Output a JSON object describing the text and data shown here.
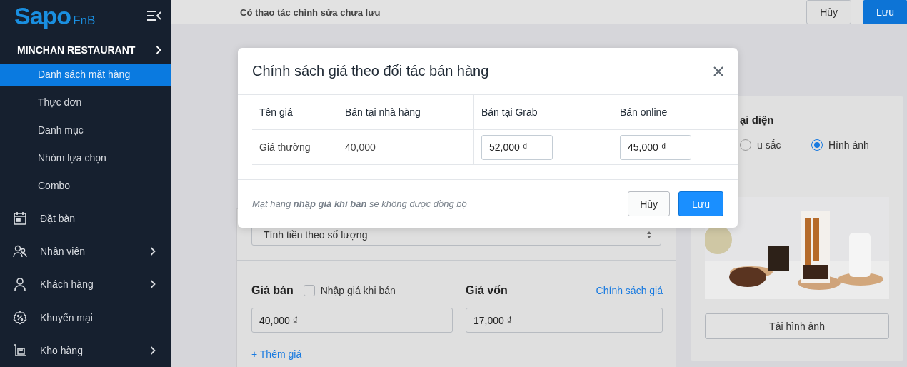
{
  "sidebar": {
    "logo": {
      "brand": "Sapo",
      "suffix": "FnB"
    },
    "store": "MINCHAN RESTAURANT",
    "sub_items": [
      {
        "label": "Danh sách mặt hàng",
        "selected": true
      },
      {
        "label": "Thực đơn",
        "selected": false
      },
      {
        "label": "Danh mục",
        "selected": false
      },
      {
        "label": "Nhóm lựa chọn",
        "selected": false
      },
      {
        "label": "Combo",
        "selected": false
      }
    ],
    "items": [
      {
        "label": "Đặt bàn",
        "has_children": false
      },
      {
        "label": "Nhân viên",
        "has_children": true
      },
      {
        "label": "Khách hàng",
        "has_children": true
      },
      {
        "label": "Khuyến mại",
        "has_children": false
      },
      {
        "label": "Kho hàng",
        "has_children": true
      }
    ]
  },
  "top_bar": {
    "message": "Có thao tác chỉnh sửa chưa lưu",
    "buttons": [
      {
        "label": "Hủy",
        "kind": "secondary"
      },
      {
        "label": "Lưu",
        "kind": "primary"
      }
    ]
  },
  "form": {
    "pricing_select": {
      "value": "Tính tiền theo số lượng"
    },
    "sale_price": {
      "label": "Giá bán",
      "checkbox": {
        "label": "Nhập giá khi bán",
        "checked": false
      },
      "value": "40,000 ₫"
    },
    "cost_price": {
      "label": "Giá vốn",
      "link": "Chính sách giá",
      "value": "17,000 ₫"
    },
    "add_price": "+ Thêm giá"
  },
  "image_card": {
    "title": "ại diện",
    "options": [
      {
        "label": "u sắc",
        "selected": false
      },
      {
        "label": "Hình ảnh",
        "selected": true
      }
    ],
    "upload_button": "Tải hình ảnh"
  },
  "modal": {
    "title": "Chính sách giá theo đối tác bán hàng",
    "table": {
      "columns": [
        "Tên giá",
        "Bán tại nhà hàng",
        "Bán tại Grab",
        "Bán online"
      ],
      "rows": [
        {
          "name": "Giá thường",
          "restaurant": "40,000",
          "grab": "52,000 ₫",
          "online": "45,000 ₫"
        }
      ]
    },
    "note": "Mặt hàng **nhập giá khi bán** sẽ không được đồng bộ",
    "buttons": [
      {
        "label": "Hủy",
        "kind": "secondary"
      },
      {
        "label": "Lưu",
        "kind": "primary"
      }
    ]
  }
}
